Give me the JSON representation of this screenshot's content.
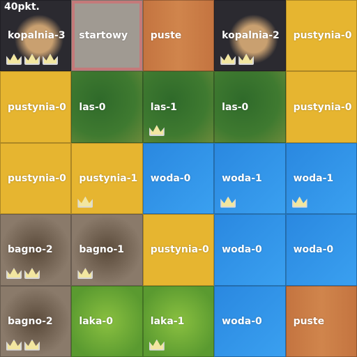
{
  "score": "40pkt.",
  "rows": [
    [
      {
        "label": "kopalnia-3",
        "type": "kopalnia",
        "crowns": 3
      },
      {
        "label": "startowy",
        "type": "startowy",
        "crowns": 0
      },
      {
        "label": "puste",
        "type": "puste",
        "crowns": 0
      },
      {
        "label": "kopalnia-2",
        "type": "kopalnia",
        "crowns": 2
      },
      {
        "label": "pustynia-0",
        "type": "pustynia",
        "crowns": 0
      }
    ],
    [
      {
        "label": "pustynia-0",
        "type": "pustynia",
        "crowns": 0
      },
      {
        "label": "las-0",
        "type": "las",
        "crowns": 0
      },
      {
        "label": "las-1",
        "type": "las",
        "crowns": 1
      },
      {
        "label": "las-0",
        "type": "las",
        "crowns": 0
      },
      {
        "label": "pustynia-0",
        "type": "pustynia",
        "crowns": 0
      }
    ],
    [
      {
        "label": "pustynia-0",
        "type": "pustynia",
        "crowns": 0
      },
      {
        "label": "pustynia-1",
        "type": "pustynia",
        "crowns": 1
      },
      {
        "label": "woda-0",
        "type": "woda",
        "crowns": 0
      },
      {
        "label": "woda-1",
        "type": "woda",
        "crowns": 1
      },
      {
        "label": "woda-1",
        "type": "woda",
        "crowns": 1
      }
    ],
    [
      {
        "label": "bagno-2",
        "type": "bagno",
        "crowns": 2
      },
      {
        "label": "bagno-1",
        "type": "bagno",
        "crowns": 1
      },
      {
        "label": "pustynia-0",
        "type": "pustynia",
        "crowns": 0
      },
      {
        "label": "woda-0",
        "type": "woda",
        "crowns": 0
      },
      {
        "label": "woda-0",
        "type": "woda",
        "crowns": 0
      }
    ],
    [
      {
        "label": "bagno-2",
        "type": "bagno",
        "crowns": 2
      },
      {
        "label": "laka-0",
        "type": "laka",
        "crowns": 0
      },
      {
        "label": "laka-1",
        "type": "laka",
        "crowns": 1
      },
      {
        "label": "woda-0",
        "type": "woda",
        "crowns": 0
      },
      {
        "label": "puste",
        "type": "puste",
        "crowns": 0
      }
    ]
  ]
}
